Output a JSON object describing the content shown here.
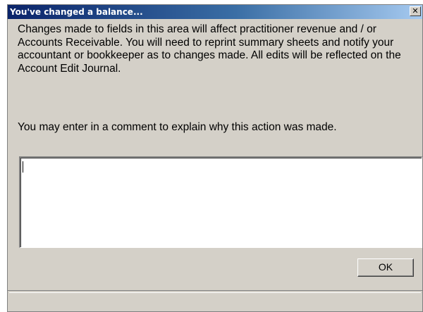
{
  "window": {
    "title": "You've changed a balance...",
    "close_glyph": "✕"
  },
  "message": {
    "paragraph1": "Changes made to fields in this area will affect practitioner revenue and / or Accounts Receivable. You will need to reprint summary sheets and notify your accountant or bookkeeper as to changes made. All edits will be reflected on the Account Edit Journal.",
    "paragraph2": "You may enter in a comment to explain why this action was made."
  },
  "comment": {
    "value": ""
  },
  "buttons": {
    "ok_label": "OK"
  },
  "colors": {
    "titlebar_start": "#0a246a",
    "titlebar_end": "#a6caf0",
    "face": "#d4d0c8"
  }
}
